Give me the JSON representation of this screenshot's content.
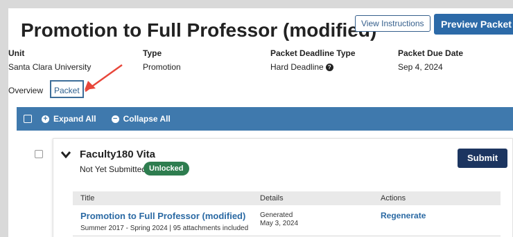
{
  "header": {
    "title": "Promotion to Full Professor (modified)",
    "view_instructions_label": "View Instructions",
    "preview_packet_label": "Preview Packet"
  },
  "meta": {
    "unit_label": "Unit",
    "unit_value": "Santa Clara University",
    "type_label": "Type",
    "type_value": "Promotion",
    "deadline_type_label": "Packet Deadline Type",
    "deadline_type_value": "Hard Deadline",
    "help_icon": "question-circle-icon",
    "due_date_label": "Packet Due Date",
    "due_date_value": "Sep 4, 2024"
  },
  "tabs": {
    "overview": "Overview",
    "packet": "Packet"
  },
  "toolbar": {
    "expand_all": "Expand All",
    "collapse_all": "Collapse All"
  },
  "section": {
    "title": "Faculty180 Vita",
    "status": "Not Yet Submitted",
    "badge": "Unlocked",
    "submit_label": "Submit",
    "table": {
      "headers": [
        "Title",
        "Details",
        "Actions"
      ],
      "rows": [
        {
          "title": "Promotion to Full Professor (modified)",
          "subtitle": "Summer 2017 - Spring 2024 | 95 attachments included",
          "details_label": "Generated",
          "details_date": "May 3, 2024",
          "action": "Regenerate"
        }
      ]
    }
  },
  "colors": {
    "toolbar": "#3f79ad",
    "primary_button": "#2c6aa8",
    "submit_button": "#1c3560",
    "badge": "#2e7d4f",
    "link": "#2a69a3",
    "annotation_arrow": "#e8463a"
  }
}
